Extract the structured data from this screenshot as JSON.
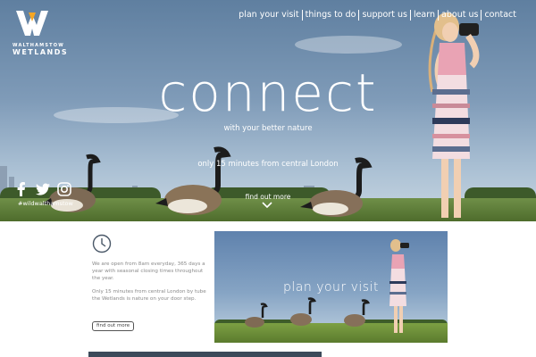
{
  "logo": {
    "line1": "WALTHAMSTOW",
    "line2": "WETLANDS",
    "brand_color": "#f5a623"
  },
  "nav": {
    "items": [
      {
        "label": "plan your visit"
      },
      {
        "label": "things to do"
      },
      {
        "label": "support us"
      },
      {
        "label": "learn"
      },
      {
        "label": "about us"
      },
      {
        "label": "contact"
      }
    ]
  },
  "hero": {
    "headline": "connect",
    "tagline": "with your better nature",
    "subline": "only 15 minutes from central London",
    "cta": "find out more",
    "cta_icon": "chevron-down-icon"
  },
  "social": {
    "icons": [
      "facebook-icon",
      "twitter-icon",
      "instagram-icon"
    ],
    "handle": "#wildwalthamstow"
  },
  "info": {
    "icon": "clock-icon",
    "paragraph1": "We are open from 8am everyday, 365 days a year with seasonal closing times throughout the year.",
    "paragraph2": "Only 15 minutes from central London by tube the Wetlands is nature on your door step.",
    "button": "find out more"
  },
  "card": {
    "title": "plan your visit"
  }
}
